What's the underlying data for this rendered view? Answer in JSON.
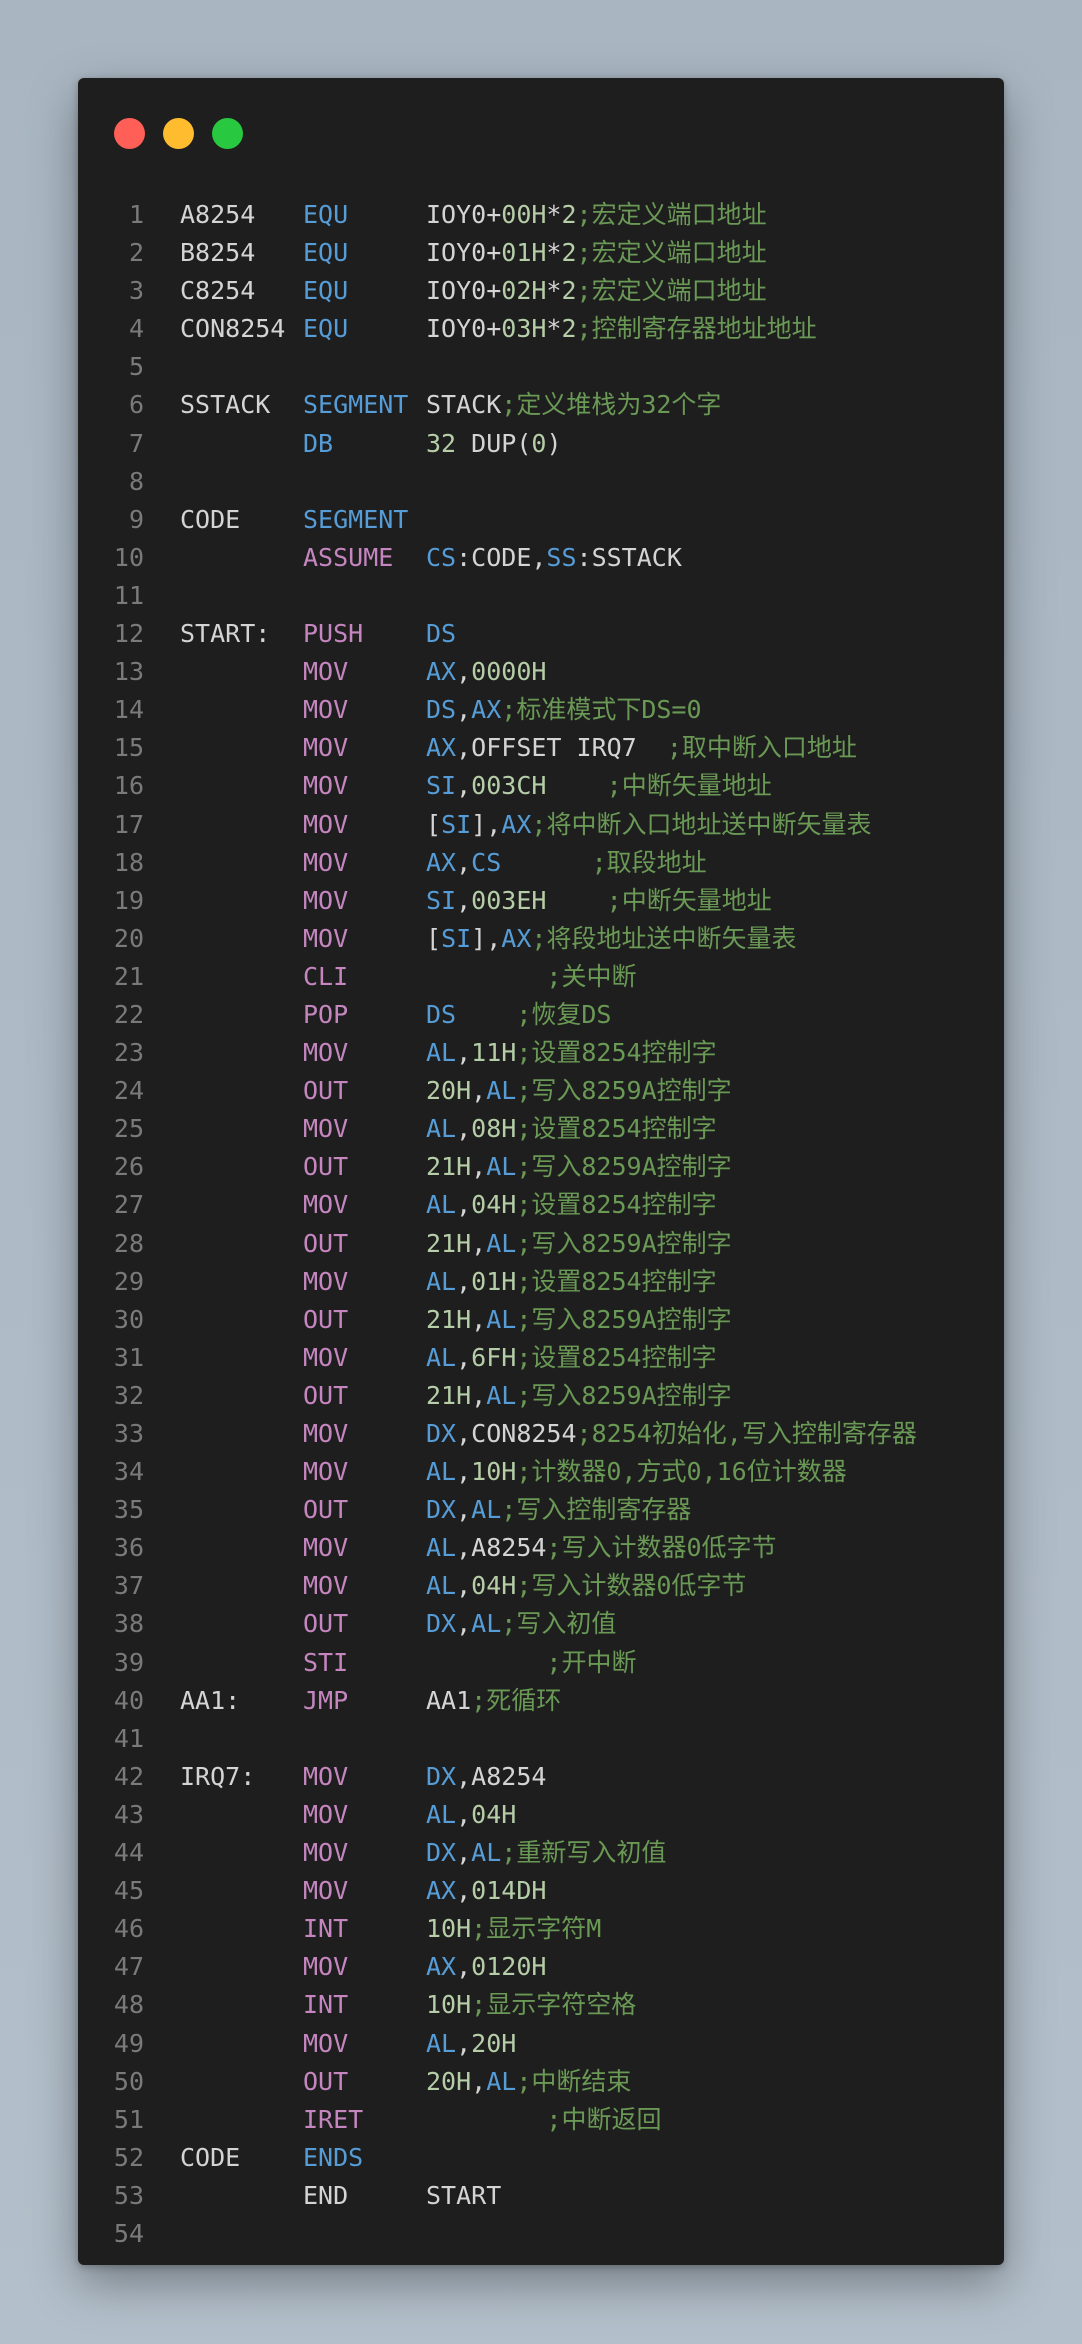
{
  "window": {
    "controls": [
      {
        "name": "close-button",
        "color": "#ff5f57"
      },
      {
        "name": "minimize-button",
        "color": "#febc2e"
      },
      {
        "name": "zoom-button",
        "color": "#28c840"
      }
    ]
  },
  "lines": [
    {
      "n": "1",
      "label": "A8254",
      "op": "EQU",
      "opk": "dir",
      "toks": [
        [
          "txt",
          "IOY0+"
        ],
        [
          "num",
          "00H"
        ],
        [
          "txt",
          "*"
        ],
        [
          "num",
          "2"
        ],
        [
          "com",
          ";宏定义端口地址"
        ]
      ]
    },
    {
      "n": "2",
      "label": "B8254",
      "op": "EQU",
      "opk": "dir",
      "toks": [
        [
          "txt",
          "IOY0+"
        ],
        [
          "num",
          "01H"
        ],
        [
          "txt",
          "*"
        ],
        [
          "num",
          "2"
        ],
        [
          "com",
          ";宏定义端口地址"
        ]
      ]
    },
    {
      "n": "3",
      "label": "C8254",
      "op": "EQU",
      "opk": "dir",
      "toks": [
        [
          "txt",
          "IOY0+"
        ],
        [
          "num",
          "02H"
        ],
        [
          "txt",
          "*"
        ],
        [
          "num",
          "2"
        ],
        [
          "com",
          ";宏定义端口地址"
        ]
      ]
    },
    {
      "n": "4",
      "label": "CON8254",
      "op": "EQU",
      "opk": "dir",
      "toks": [
        [
          "txt",
          "IOY0+"
        ],
        [
          "num",
          "03H"
        ],
        [
          "txt",
          "*"
        ],
        [
          "num",
          "2"
        ],
        [
          "com",
          ";控制寄存器地址地址"
        ]
      ]
    },
    {
      "n": "5",
      "label": "",
      "op": "",
      "opk": "dir",
      "toks": []
    },
    {
      "n": "6",
      "label": "SSTACK",
      "op": "SEGMENT",
      "opk": "dir",
      "toks": [
        [
          "txt",
          "STACK"
        ],
        [
          "com",
          ";定义堆栈为32个字"
        ]
      ]
    },
    {
      "n": "7",
      "label": "",
      "op": "DB",
      "opk": "dir",
      "toks": [
        [
          "num",
          "32"
        ],
        [
          "txt",
          " DUP("
        ],
        [
          "num",
          "0"
        ],
        [
          "txt",
          ")"
        ]
      ]
    },
    {
      "n": "8",
      "label": "",
      "op": "",
      "opk": "dir",
      "toks": []
    },
    {
      "n": "9",
      "label": "CODE",
      "op": "SEGMENT",
      "opk": "dir",
      "toks": []
    },
    {
      "n": "10",
      "label": "",
      "op": "ASSUME",
      "opk": "ins",
      "toks": [
        [
          "reg",
          "CS"
        ],
        [
          "txt",
          ":CODE,"
        ],
        [
          "reg",
          "SS"
        ],
        [
          "txt",
          ":SSTACK"
        ]
      ]
    },
    {
      "n": "11",
      "label": "",
      "op": "",
      "opk": "dir",
      "toks": []
    },
    {
      "n": "12",
      "label": "START:",
      "op": "PUSH",
      "opk": "ins",
      "toks": [
        [
          "reg",
          "DS"
        ]
      ]
    },
    {
      "n": "13",
      "label": "",
      "op": "MOV",
      "opk": "ins",
      "toks": [
        [
          "reg",
          "AX"
        ],
        [
          "txt",
          ","
        ],
        [
          "num",
          "0000H"
        ]
      ]
    },
    {
      "n": "14",
      "label": "",
      "op": "MOV",
      "opk": "ins",
      "toks": [
        [
          "reg",
          "DS"
        ],
        [
          "txt",
          ","
        ],
        [
          "reg",
          "AX"
        ],
        [
          "com",
          ";标准模式下DS=0"
        ]
      ]
    },
    {
      "n": "15",
      "label": "",
      "op": "MOV",
      "opk": "ins",
      "toks": [
        [
          "reg",
          "AX"
        ],
        [
          "txt",
          ",OFFSET IRQ7  "
        ],
        [
          "com",
          ";取中断入口地址"
        ]
      ]
    },
    {
      "n": "16",
      "label": "",
      "op": "MOV",
      "opk": "ins",
      "toks": [
        [
          "reg",
          "SI"
        ],
        [
          "txt",
          ","
        ],
        [
          "num",
          "003CH"
        ],
        [
          "txt",
          "    "
        ],
        [
          "com",
          ";中断矢量地址"
        ]
      ]
    },
    {
      "n": "17",
      "label": "",
      "op": "MOV",
      "opk": "ins",
      "toks": [
        [
          "txt",
          "["
        ],
        [
          "reg",
          "SI"
        ],
        [
          "txt",
          "],"
        ],
        [
          "reg",
          "AX"
        ],
        [
          "com",
          ";将中断入口地址送中断矢量表"
        ]
      ]
    },
    {
      "n": "18",
      "label": "",
      "op": "MOV",
      "opk": "ins",
      "toks": [
        [
          "reg",
          "AX"
        ],
        [
          "txt",
          ","
        ],
        [
          "reg",
          "CS"
        ],
        [
          "txt",
          "      "
        ],
        [
          "com",
          ";取段地址"
        ]
      ]
    },
    {
      "n": "19",
      "label": "",
      "op": "MOV",
      "opk": "ins",
      "toks": [
        [
          "reg",
          "SI"
        ],
        [
          "txt",
          ","
        ],
        [
          "num",
          "003EH"
        ],
        [
          "txt",
          "    "
        ],
        [
          "com",
          ";中断矢量地址"
        ]
      ]
    },
    {
      "n": "20",
      "label": "",
      "op": "MOV",
      "opk": "ins",
      "toks": [
        [
          "txt",
          "["
        ],
        [
          "reg",
          "SI"
        ],
        [
          "txt",
          "],"
        ],
        [
          "reg",
          "AX"
        ],
        [
          "com",
          ";将段地址送中断矢量表"
        ]
      ]
    },
    {
      "n": "21",
      "label": "",
      "op": "CLI",
      "opk": "ins",
      "toks": [
        [
          "txt",
          "        "
        ],
        [
          "com",
          ";关中断"
        ]
      ]
    },
    {
      "n": "22",
      "label": "",
      "op": "POP",
      "opk": "ins",
      "toks": [
        [
          "reg",
          "DS"
        ],
        [
          "txt",
          "    "
        ],
        [
          "com",
          ";恢复DS"
        ]
      ]
    },
    {
      "n": "23",
      "label": "",
      "op": "MOV",
      "opk": "ins",
      "toks": [
        [
          "reg",
          "AL"
        ],
        [
          "txt",
          ","
        ],
        [
          "num",
          "11H"
        ],
        [
          "com",
          ";设置8254控制字"
        ]
      ]
    },
    {
      "n": "24",
      "label": "",
      "op": "OUT",
      "opk": "ins",
      "toks": [
        [
          "num",
          "20H"
        ],
        [
          "txt",
          ","
        ],
        [
          "reg",
          "AL"
        ],
        [
          "com",
          ";写入8259A控制字"
        ]
      ]
    },
    {
      "n": "25",
      "label": "",
      "op": "MOV",
      "opk": "ins",
      "toks": [
        [
          "reg",
          "AL"
        ],
        [
          "txt",
          ","
        ],
        [
          "num",
          "08H"
        ],
        [
          "com",
          ";设置8254控制字"
        ]
      ]
    },
    {
      "n": "26",
      "label": "",
      "op": "OUT",
      "opk": "ins",
      "toks": [
        [
          "num",
          "21H"
        ],
        [
          "txt",
          ","
        ],
        [
          "reg",
          "AL"
        ],
        [
          "com",
          ";写入8259A控制字"
        ]
      ]
    },
    {
      "n": "27",
      "label": "",
      "op": "MOV",
      "opk": "ins",
      "toks": [
        [
          "reg",
          "AL"
        ],
        [
          "txt",
          ","
        ],
        [
          "num",
          "04H"
        ],
        [
          "com",
          ";设置8254控制字"
        ]
      ]
    },
    {
      "n": "28",
      "label": "",
      "op": "OUT",
      "opk": "ins",
      "toks": [
        [
          "num",
          "21H"
        ],
        [
          "txt",
          ","
        ],
        [
          "reg",
          "AL"
        ],
        [
          "com",
          ";写入8259A控制字"
        ]
      ]
    },
    {
      "n": "29",
      "label": "",
      "op": "MOV",
      "opk": "ins",
      "toks": [
        [
          "reg",
          "AL"
        ],
        [
          "txt",
          ","
        ],
        [
          "num",
          "01H"
        ],
        [
          "com",
          ";设置8254控制字"
        ]
      ]
    },
    {
      "n": "30",
      "label": "",
      "op": "OUT",
      "opk": "ins",
      "toks": [
        [
          "num",
          "21H"
        ],
        [
          "txt",
          ","
        ],
        [
          "reg",
          "AL"
        ],
        [
          "com",
          ";写入8259A控制字"
        ]
      ]
    },
    {
      "n": "31",
      "label": "",
      "op": "MOV",
      "opk": "ins",
      "toks": [
        [
          "reg",
          "AL"
        ],
        [
          "txt",
          ","
        ],
        [
          "num",
          "6FH"
        ],
        [
          "com",
          ";设置8254控制字"
        ]
      ]
    },
    {
      "n": "32",
      "label": "",
      "op": "OUT",
      "opk": "ins",
      "toks": [
        [
          "num",
          "21H"
        ],
        [
          "txt",
          ","
        ],
        [
          "reg",
          "AL"
        ],
        [
          "com",
          ";写入8259A控制字"
        ]
      ]
    },
    {
      "n": "33",
      "label": "",
      "op": "MOV",
      "opk": "ins",
      "toks": [
        [
          "reg",
          "DX"
        ],
        [
          "txt",
          ",CON8254"
        ],
        [
          "com",
          ";8254初始化,写入控制寄存器"
        ]
      ]
    },
    {
      "n": "34",
      "label": "",
      "op": "MOV",
      "opk": "ins",
      "toks": [
        [
          "reg",
          "AL"
        ],
        [
          "txt",
          ","
        ],
        [
          "num",
          "10H"
        ],
        [
          "com",
          ";计数器0,方式0,16位计数器"
        ]
      ]
    },
    {
      "n": "35",
      "label": "",
      "op": "OUT",
      "opk": "ins",
      "toks": [
        [
          "reg",
          "DX"
        ],
        [
          "txt",
          ","
        ],
        [
          "reg",
          "AL"
        ],
        [
          "com",
          ";写入控制寄存器"
        ]
      ]
    },
    {
      "n": "36",
      "label": "",
      "op": "MOV",
      "opk": "ins",
      "toks": [
        [
          "reg",
          "AL"
        ],
        [
          "txt",
          ",A8254"
        ],
        [
          "com",
          ";写入计数器0低字节"
        ]
      ]
    },
    {
      "n": "37",
      "label": "",
      "op": "MOV",
      "opk": "ins",
      "toks": [
        [
          "reg",
          "AL"
        ],
        [
          "txt",
          ","
        ],
        [
          "num",
          "04H"
        ],
        [
          "com",
          ";写入计数器0低字节"
        ]
      ]
    },
    {
      "n": "38",
      "label": "",
      "op": "OUT",
      "opk": "ins",
      "toks": [
        [
          "reg",
          "DX"
        ],
        [
          "txt",
          ","
        ],
        [
          "reg",
          "AL"
        ],
        [
          "com",
          ";写入初值"
        ]
      ]
    },
    {
      "n": "39",
      "label": "",
      "op": "STI",
      "opk": "ins",
      "toks": [
        [
          "txt",
          "        "
        ],
        [
          "com",
          ";开中断"
        ]
      ]
    },
    {
      "n": "40",
      "label": "AA1:",
      "op": "JMP",
      "opk": "ins",
      "toks": [
        [
          "txt",
          "AA1"
        ],
        [
          "com",
          ";死循环"
        ]
      ]
    },
    {
      "n": "41",
      "label": "",
      "op": "",
      "opk": "dir",
      "toks": []
    },
    {
      "n": "42",
      "label": "IRQ7:",
      "op": "MOV",
      "opk": "ins",
      "toks": [
        [
          "reg",
          "DX"
        ],
        [
          "txt",
          ",A8254"
        ]
      ]
    },
    {
      "n": "43",
      "label": "",
      "op": "MOV",
      "opk": "ins",
      "toks": [
        [
          "reg",
          "AL"
        ],
        [
          "txt",
          ","
        ],
        [
          "num",
          "04H"
        ]
      ]
    },
    {
      "n": "44",
      "label": "",
      "op": "MOV",
      "opk": "ins",
      "toks": [
        [
          "reg",
          "DX"
        ],
        [
          "txt",
          ","
        ],
        [
          "reg",
          "AL"
        ],
        [
          "com",
          ";重新写入初值"
        ]
      ]
    },
    {
      "n": "45",
      "label": "",
      "op": "MOV",
      "opk": "ins",
      "toks": [
        [
          "reg",
          "AX"
        ],
        [
          "txt",
          ","
        ],
        [
          "num",
          "014DH"
        ]
      ]
    },
    {
      "n": "46",
      "label": "",
      "op": "INT",
      "opk": "ins",
      "toks": [
        [
          "num",
          "10H"
        ],
        [
          "com",
          ";显示字符M"
        ]
      ]
    },
    {
      "n": "47",
      "label": "",
      "op": "MOV",
      "opk": "ins",
      "toks": [
        [
          "reg",
          "AX"
        ],
        [
          "txt",
          ","
        ],
        [
          "num",
          "0120H"
        ]
      ]
    },
    {
      "n": "48",
      "label": "",
      "op": "INT",
      "opk": "ins",
      "toks": [
        [
          "num",
          "10H"
        ],
        [
          "com",
          ";显示字符空格"
        ]
      ]
    },
    {
      "n": "49",
      "label": "",
      "op": "MOV",
      "opk": "ins",
      "toks": [
        [
          "reg",
          "AL"
        ],
        [
          "txt",
          ","
        ],
        [
          "num",
          "20H"
        ]
      ]
    },
    {
      "n": "50",
      "label": "",
      "op": "OUT",
      "opk": "ins",
      "toks": [
        [
          "num",
          "20H"
        ],
        [
          "txt",
          ","
        ],
        [
          "reg",
          "AL"
        ],
        [
          "com",
          ";中断结束"
        ]
      ]
    },
    {
      "n": "51",
      "label": "",
      "op": "IRET",
      "opk": "ins",
      "toks": [
        [
          "txt",
          "        "
        ],
        [
          "com",
          ";中断返回"
        ]
      ]
    },
    {
      "n": "52",
      "label": "CODE",
      "op": "ENDS",
      "opk": "dir",
      "toks": []
    },
    {
      "n": "53",
      "label": "",
      "op": "END",
      "opk": "txt",
      "toks": [
        [
          "txt",
          "START"
        ]
      ]
    },
    {
      "n": "54",
      "label": "",
      "op": "",
      "opk": "dir",
      "toks": []
    }
  ]
}
